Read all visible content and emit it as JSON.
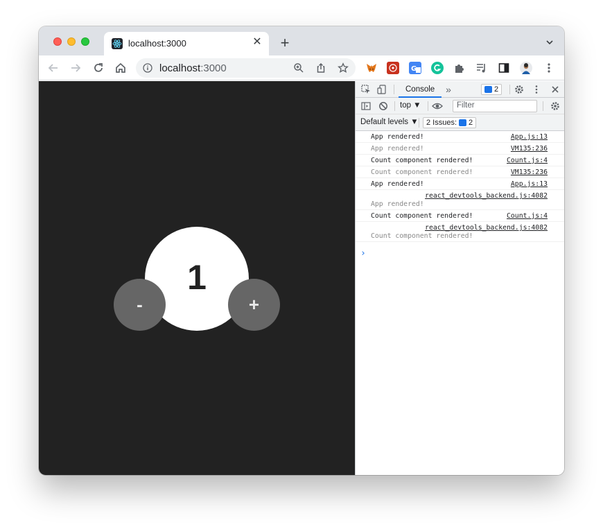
{
  "tab": {
    "title": "localhost:3000"
  },
  "omnibox": {
    "host": "localhost",
    "port": ":3000"
  },
  "app": {
    "count": "1",
    "decrement_label": "-",
    "increment_label": "+"
  },
  "devtools": {
    "active_tab": "Console",
    "more_tabs": "»",
    "messages_badge": "2",
    "context": "top ▼",
    "filter_placeholder": "Filter",
    "levels": "Default levels ▼",
    "issues_label": "2 Issues:",
    "issues_count": "2",
    "logs": [
      {
        "msg": "App rendered!",
        "src": "App.js:13",
        "dim": false
      },
      {
        "msg": "App rendered!",
        "src": "VM135:236",
        "dim": true
      },
      {
        "msg": "Count component rendered!",
        "src": "Count.js:4",
        "dim": false
      },
      {
        "msg": "Count component rendered!",
        "src": "VM135:236",
        "dim": true
      },
      {
        "msg": "App rendered!",
        "src": "App.js:13",
        "dim": false
      },
      {
        "msg": "App rendered!",
        "src": "react_devtools_backend.js:4082",
        "dim": true
      },
      {
        "msg": "Count component rendered!",
        "src": "Count.js:4",
        "dim": false
      },
      {
        "msg": "Count component rendered!",
        "src": "react_devtools_backend.js:4082",
        "dim": true
      }
    ],
    "prompt": "›"
  }
}
